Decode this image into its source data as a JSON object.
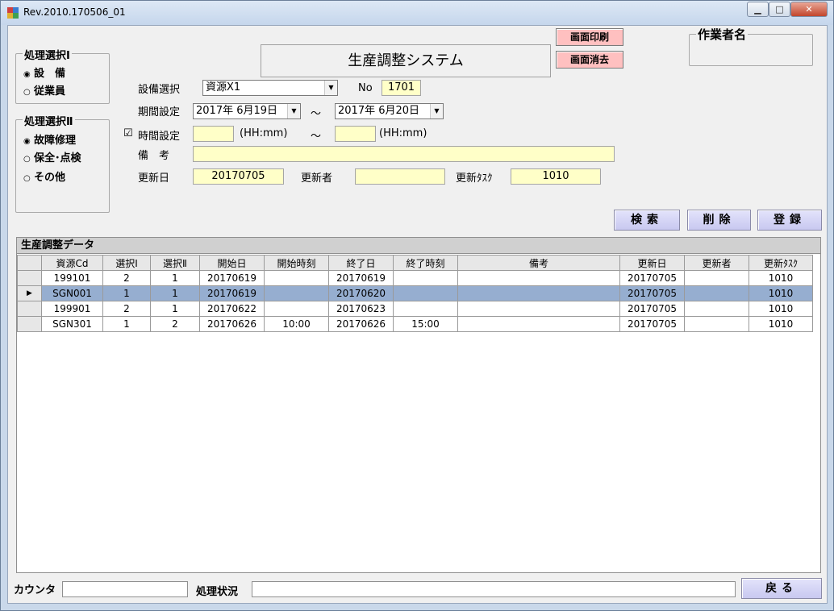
{
  "window": {
    "title": "Rev.2010.170506_01",
    "minimize": "▁",
    "maximize": "□",
    "close": "✕"
  },
  "group1": {
    "legend": "処理選択Ⅰ",
    "options": [
      {
        "label": "設　備",
        "checked": true
      },
      {
        "label": "従業員",
        "checked": false
      }
    ]
  },
  "group2": {
    "legend": "処理選択Ⅱ",
    "options": [
      {
        "label": "故障修理",
        "checked": true
      },
      {
        "label": "保全･点検",
        "checked": false
      },
      {
        "label": "その他",
        "checked": false
      }
    ]
  },
  "header": {
    "system_title": "生産調整システム",
    "print_button": "画面印刷",
    "clear_button": "画面消去",
    "operator_legend": "作業者名"
  },
  "form": {
    "equipment_label": "設備選択",
    "equipment_value": "資源X1",
    "no_label": "No",
    "no_value": "1701",
    "period_label": "期間設定",
    "period_from": "2017年  6月19日",
    "tilde": "～",
    "period_to": "2017年  6月20日",
    "time_checkbox": "☑",
    "time_label": "時間設定",
    "time_from": "",
    "time_hint1": "(HH:mm)",
    "time_to": "",
    "time_hint2": "(HH:mm)",
    "remarks_label": "備　考",
    "remarks_value": "",
    "updated_label": "更新日",
    "updated_value": "20170705",
    "updater_label": "更新者",
    "updater_value": "",
    "task_label": "更新ﾀｽｸ",
    "task_value": "1010"
  },
  "actions": {
    "search": "検索",
    "delete": "削除",
    "register": "登録",
    "back": "戻る"
  },
  "grid": {
    "caption": "生産調整データ",
    "columns": [
      "資源Cd",
      "選択Ⅰ",
      "選択Ⅱ",
      "開始日",
      "開始時刻",
      "終了日",
      "終了時刻",
      "備考",
      "更新日",
      "更新者",
      "更新ﾀｽｸ"
    ],
    "rows": [
      [
        "199101",
        "2",
        "1",
        "20170619",
        "",
        "20170619",
        "",
        "",
        "20170705",
        "",
        "1010"
      ],
      [
        "SGN001",
        "1",
        "1",
        "20170619",
        "",
        "20170620",
        "",
        "",
        "20170705",
        "",
        "1010"
      ],
      [
        "199901",
        "2",
        "1",
        "20170622",
        "",
        "20170623",
        "",
        "",
        "20170705",
        "",
        "1010"
      ],
      [
        "SGN301",
        "1",
        "2",
        "20170626",
        "10:00",
        "20170626",
        "15:00",
        "",
        "20170705",
        "",
        "1010"
      ]
    ],
    "selected_row": 1,
    "row_indicator": "▶"
  },
  "footer": {
    "counter_label": "カウンタ",
    "counter_value": "",
    "status_label": "処理状況",
    "status_value": ""
  }
}
